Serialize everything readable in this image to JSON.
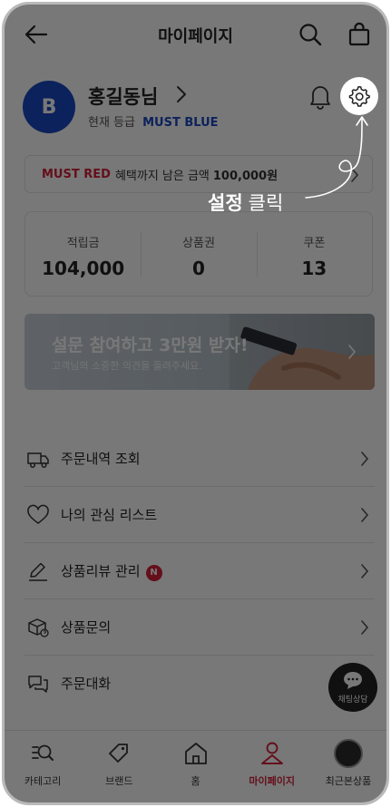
{
  "header": {
    "title": "마이페이지"
  },
  "profile": {
    "avatar_letter": "B",
    "name": "홍길동님",
    "grade_label": "현재 등급",
    "grade_value": "MUST BLUE"
  },
  "benefit": {
    "grade": "MUST RED",
    "text": "혜택까지 남은 금액",
    "amount": "100,000원"
  },
  "points": [
    {
      "label": "적립금",
      "value": "104,000"
    },
    {
      "label": "상품권",
      "value": "0"
    },
    {
      "label": "쿠폰",
      "value": "13"
    }
  ],
  "survey": {
    "title": "설문 참여하고 3만원 받자!",
    "subtitle": "고객님의 소중한 의견을 들려주세요."
  },
  "menu": [
    {
      "label": "주문내역 조회",
      "icon": "truck-icon"
    },
    {
      "label": "나의 관심 리스트",
      "icon": "heart-icon"
    },
    {
      "label": "상품리뷰 관리",
      "icon": "pen-icon",
      "badge": "N"
    },
    {
      "label": "상품문의",
      "icon": "box-question-icon"
    },
    {
      "label": "주문대화",
      "icon": "chat-bubbles-icon"
    }
  ],
  "chat_button": {
    "label": "채팅상담"
  },
  "bottom_nav": [
    {
      "label": "카테고리",
      "icon": "category-search-icon"
    },
    {
      "label": "브랜드",
      "icon": "tag-icon"
    },
    {
      "label": "홈",
      "icon": "home-icon"
    },
    {
      "label": "마이페이지",
      "icon": "person-icon",
      "active": true
    },
    {
      "label": "최근본상품",
      "icon": "recent-product-thumb"
    }
  ],
  "annotation": {
    "bold": "설정",
    "rest": "클릭"
  },
  "colors": {
    "brand_blue": "#1b49c4",
    "brand_red": "#d4213a",
    "overlay": "rgba(0,0,0,0.53)"
  }
}
